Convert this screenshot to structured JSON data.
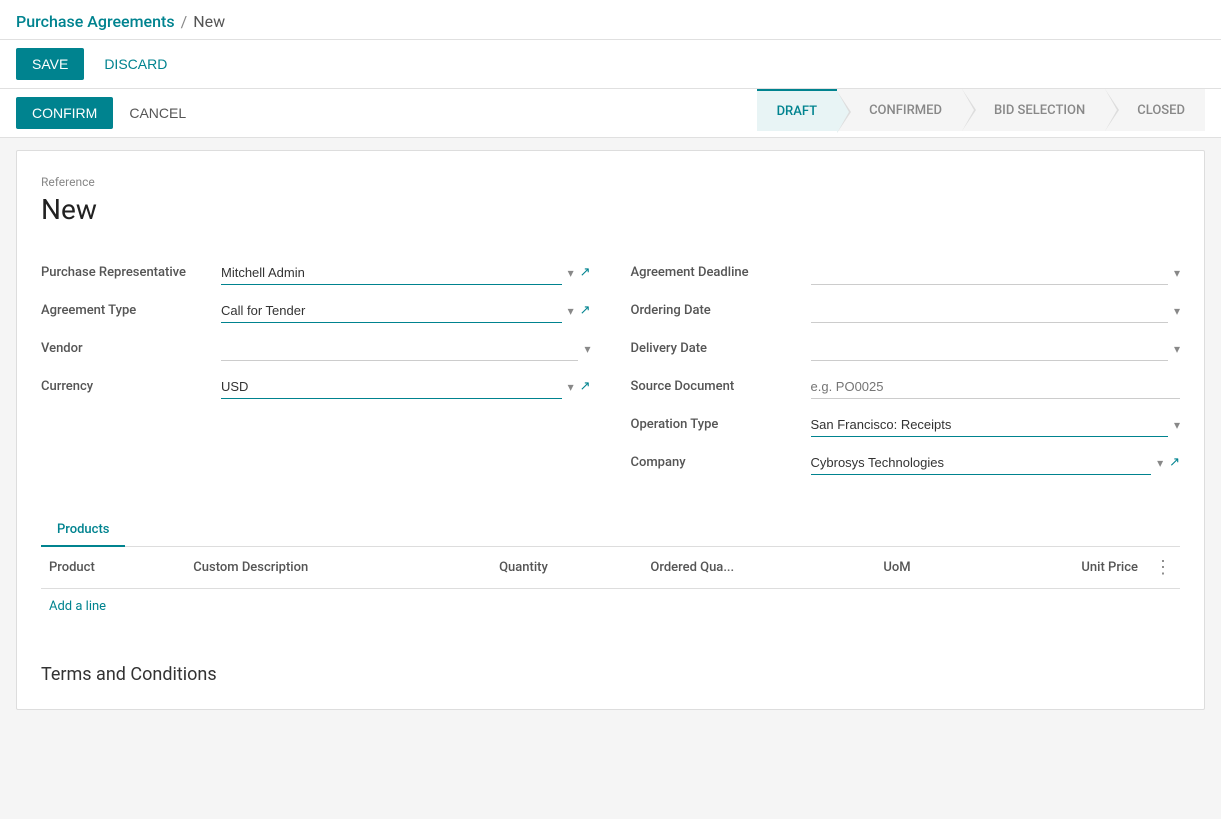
{
  "breadcrumb": {
    "parent": "Purchase Agreements",
    "separator": "/",
    "current": "New"
  },
  "toolbar": {
    "save_label": "SAVE",
    "discard_label": "DISCARD"
  },
  "status_actions": {
    "confirm_label": "CONFIRM",
    "cancel_label": "CANCEL"
  },
  "status_steps": [
    {
      "id": "draft",
      "label": "DRAFT",
      "active": true
    },
    {
      "id": "confirmed",
      "label": "CONFIRMED",
      "active": false
    },
    {
      "id": "bid_selection",
      "label": "BID SELECTION",
      "active": false
    },
    {
      "id": "closed",
      "label": "CLOSED",
      "active": false
    }
  ],
  "form": {
    "reference_label": "Reference",
    "reference_value": "New",
    "left": {
      "purchase_rep_label": "Purchase Representative",
      "purchase_rep_value": "Mitchell Admin",
      "agreement_type_label": "Agreement Type",
      "agreement_type_value": "Call for Tender",
      "vendor_label": "Vendor",
      "vendor_value": "",
      "currency_label": "Currency",
      "currency_value": "USD"
    },
    "right": {
      "agreement_deadline_label": "Agreement Deadline",
      "agreement_deadline_value": "",
      "ordering_date_label": "Ordering Date",
      "ordering_date_value": "",
      "delivery_date_label": "Delivery Date",
      "delivery_date_value": "",
      "source_document_label": "Source Document",
      "source_document_placeholder": "e.g. PO0025",
      "operation_type_label": "Operation Type",
      "operation_type_value": "San Francisco: Receipts",
      "company_label": "Company",
      "company_value": "Cybrosys Technologies"
    }
  },
  "products_tab": {
    "label": "Products",
    "columns": {
      "product": "Product",
      "custom_description": "Custom Description",
      "quantity": "Quantity",
      "ordered_quantity": "Ordered Qua...",
      "uom": "UoM",
      "unit_price": "Unit Price"
    },
    "add_line_label": "Add a line"
  },
  "terms_section": {
    "title": "Terms and Conditions"
  },
  "icons": {
    "dropdown": "▾",
    "external_link": "↗",
    "more_options": "⋮"
  }
}
